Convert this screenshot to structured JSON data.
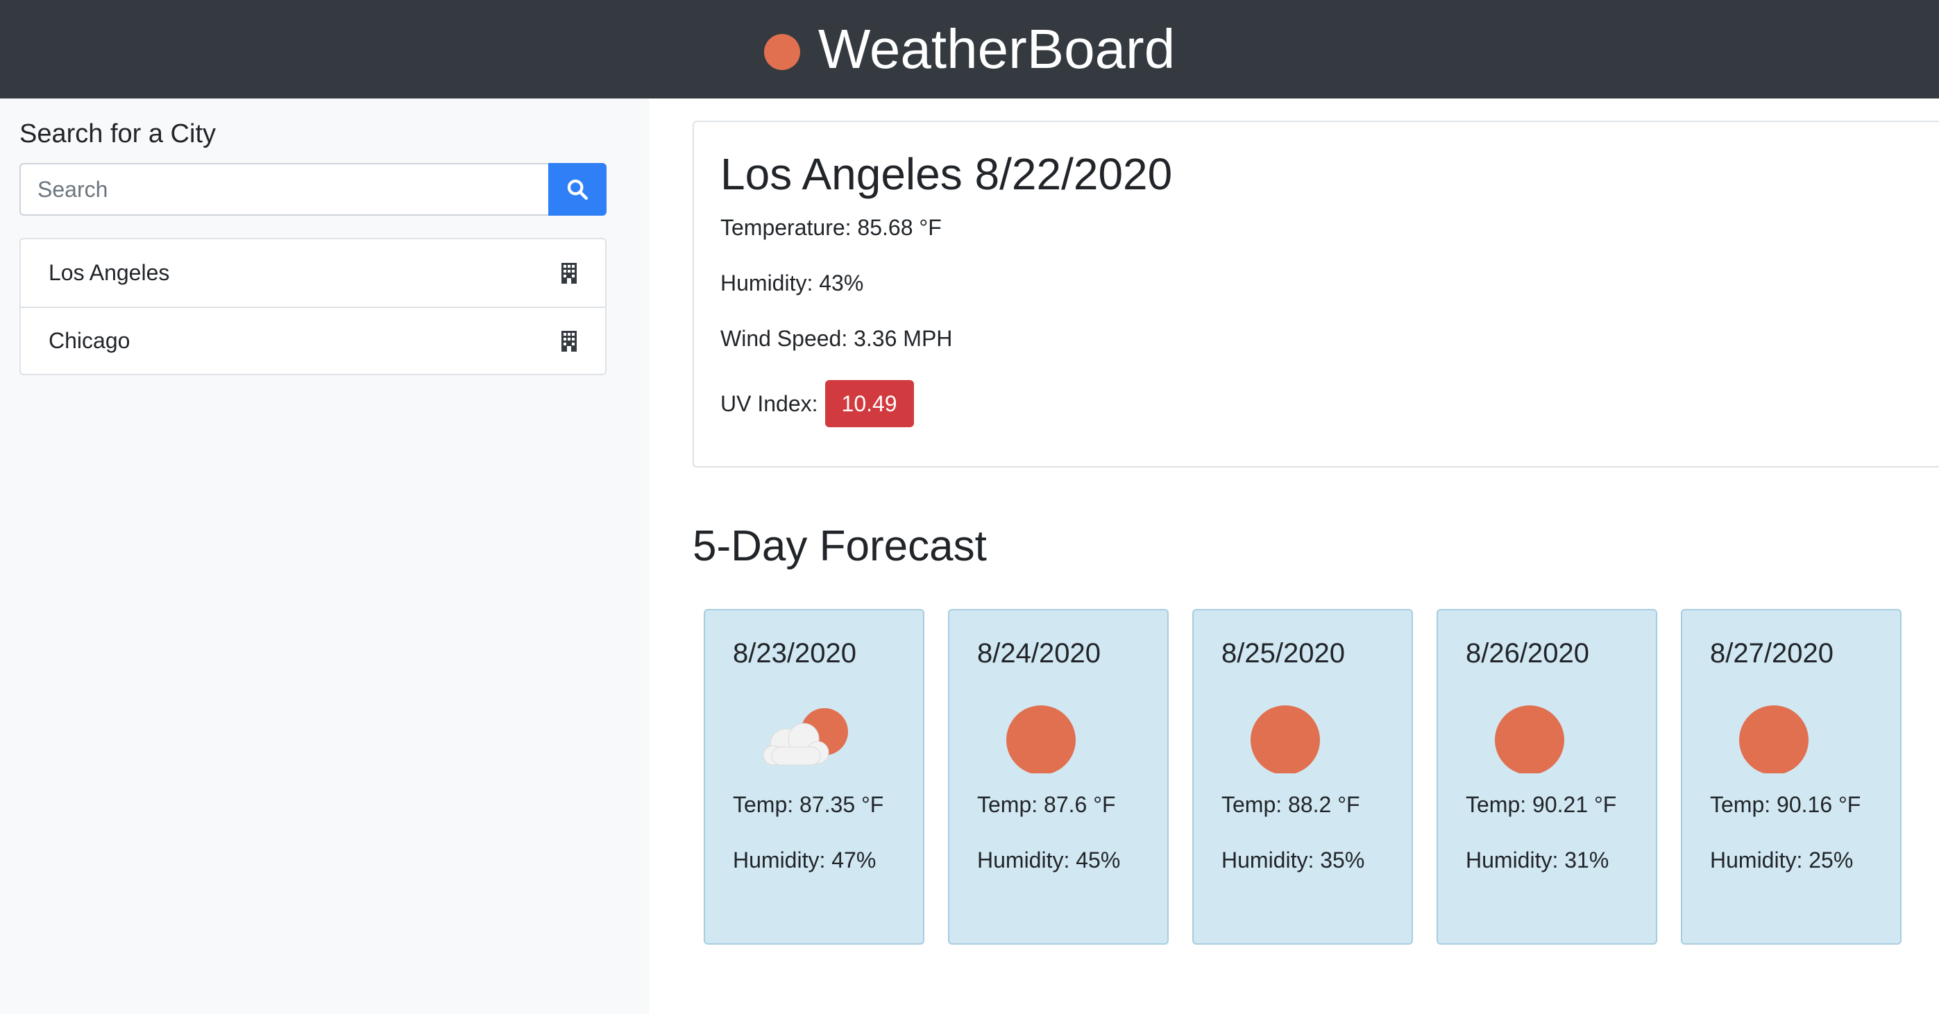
{
  "app": {
    "title": "WeatherBoard",
    "brand_icon": "sun-icon"
  },
  "sidebar": {
    "title": "Search for a City",
    "search_placeholder": "Search",
    "search_value": "",
    "search_icon": "search-icon",
    "cities": [
      {
        "name": "Los Angeles",
        "icon": "building-icon"
      },
      {
        "name": "Chicago",
        "icon": "building-icon"
      }
    ]
  },
  "current": {
    "heading": "Los Angeles 8/22/2020",
    "temperature": "Temperature: 85.68 °F",
    "humidity": "Humidity: 43%",
    "wind": "Wind Speed: 3.36 MPH",
    "uv_label": "UV Index:",
    "uv_value": "10.49"
  },
  "forecast": {
    "title": "5-Day Forecast",
    "days": [
      {
        "date": "8/23/2020",
        "icon": "partly-cloudy-icon",
        "temp": "Temp: 87.35 °F",
        "humidity": "Humidity: 47%"
      },
      {
        "date": "8/24/2020",
        "icon": "sun-icon",
        "temp": "Temp: 87.6 °F",
        "humidity": "Humidity: 45%"
      },
      {
        "date": "8/25/2020",
        "icon": "sun-icon",
        "temp": "Temp: 88.2 °F",
        "humidity": "Humidity: 35%"
      },
      {
        "date": "8/26/2020",
        "icon": "sun-icon",
        "temp": "Temp: 90.21 °F",
        "humidity": "Humidity: 31%"
      },
      {
        "date": "8/27/2020",
        "icon": "sun-icon",
        "temp": "Temp: 90.16 °F",
        "humidity": "Humidity: 25%"
      }
    ]
  },
  "colors": {
    "navbar": "#343a40",
    "sun": "#e07050",
    "search_button": "#2f7ff6",
    "uv_badge": "#d13a3f",
    "forecast_card": "#d1e7f2"
  }
}
